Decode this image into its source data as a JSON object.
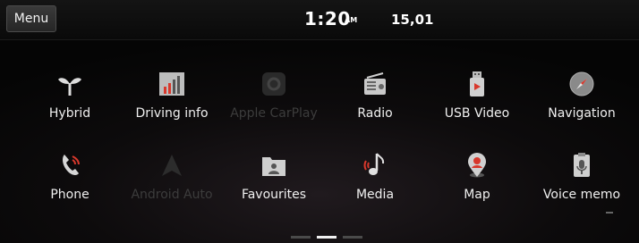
{
  "header": {
    "menu_label": "Menu",
    "time": "1:20",
    "ampm": "AM",
    "date": "15,01"
  },
  "apps_row1": [
    {
      "label": "Hybrid",
      "icon": "sprout-icon",
      "enabled": true
    },
    {
      "label": "Driving info",
      "icon": "bar-chart-icon",
      "enabled": true
    },
    {
      "label": "Apple CarPlay",
      "icon": "carplay-icon",
      "enabled": false
    },
    {
      "label": "Radio",
      "icon": "radio-icon",
      "enabled": true
    },
    {
      "label": "USB Video",
      "icon": "usb-video-icon",
      "enabled": true
    },
    {
      "label": "Navigation",
      "icon": "compass-icon",
      "enabled": true
    }
  ],
  "apps_row2": [
    {
      "label": "Phone",
      "icon": "phone-icon",
      "enabled": true
    },
    {
      "label": "Android Auto",
      "icon": "android-auto-icon",
      "enabled": false
    },
    {
      "label": "Favourites",
      "icon": "favourites-folder-icon",
      "enabled": true
    },
    {
      "label": "Media",
      "icon": "music-note-icon",
      "enabled": true
    },
    {
      "label": "Map",
      "icon": "map-pin-icon",
      "enabled": true
    },
    {
      "label": "Voice memo",
      "icon": "voice-memo-icon",
      "enabled": true
    }
  ],
  "pager": {
    "pages": 3,
    "active": 2
  },
  "colors": {
    "accent_red": "#d8382c",
    "disabled_text": "#3c3c3c",
    "text": "#f0f0f0"
  }
}
